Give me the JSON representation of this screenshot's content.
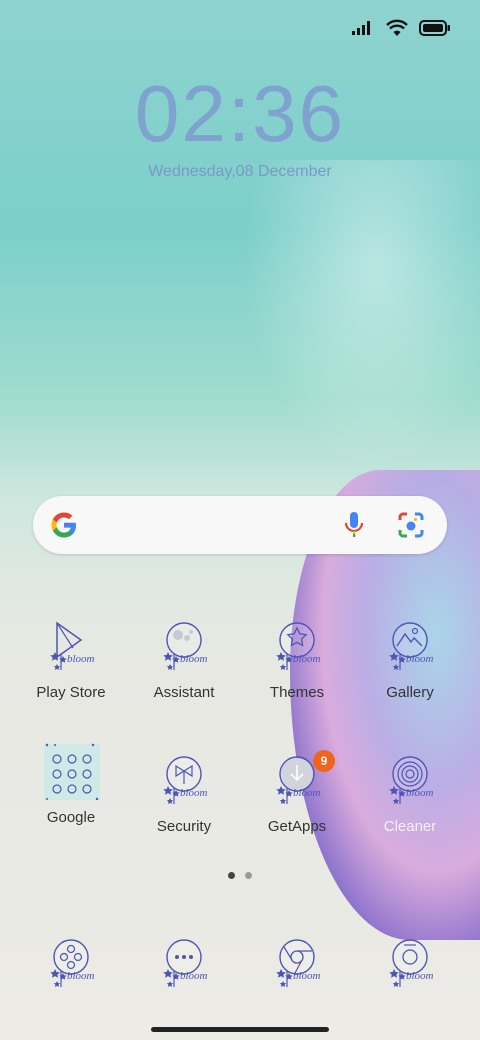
{
  "clock": {
    "time": "02:36",
    "date": "Wednesday,08 December"
  },
  "status": {
    "signal_icon": "signal-icon",
    "wifi_icon": "wifi-icon",
    "battery_icon": "battery-icon"
  },
  "search": {
    "logo_icon": "google-g-icon",
    "mic_icon": "microphone-icon",
    "lens_icon": "camera-lens-icon"
  },
  "apps_row1": [
    {
      "label": "Play Store",
      "icon": "play-store-icon"
    },
    {
      "label": "Assistant",
      "icon": "assistant-icon"
    },
    {
      "label": "Themes",
      "icon": "themes-icon"
    },
    {
      "label": "Gallery",
      "icon": "gallery-icon"
    }
  ],
  "apps_row2": [
    {
      "label": "Google",
      "icon": "google-folder-icon"
    },
    {
      "label": "Security",
      "icon": "security-icon"
    },
    {
      "label": "GetApps",
      "icon": "getapps-icon",
      "badge": "9"
    },
    {
      "label": "Cleaner",
      "icon": "cleaner-icon"
    }
  ],
  "dock": [
    {
      "icon": "phone-icon"
    },
    {
      "icon": "messages-icon"
    },
    {
      "icon": "chrome-icon"
    },
    {
      "icon": "camera-icon"
    }
  ],
  "icon_caption": "bloom",
  "pager": {
    "pages": 2,
    "current": 1
  },
  "colors": {
    "icon_ink": "#4d55b5",
    "clock": "#7fa2cf",
    "badge": "#f0641e"
  }
}
